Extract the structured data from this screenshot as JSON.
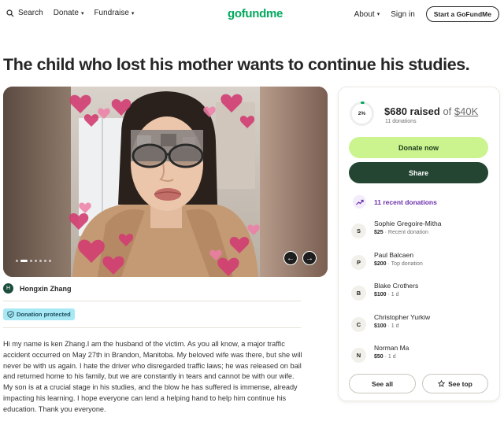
{
  "nav": {
    "search_label": "Search",
    "donate_label": "Donate",
    "fundraise_label": "Fundraise",
    "logo_text": "gofundme",
    "about_label": "About",
    "signin_label": "Sign in",
    "start_label": "Start a GoFundMe",
    "caret": "▾"
  },
  "campaign": {
    "title": "The child who lost his mother wants to continue his studies.",
    "organizer_initial": "H",
    "organizer_name": "Hongxin Zhang",
    "badge_label": "Donation protected",
    "story": "Hi my name is ken Zhang.I am the husband of the victim. As you all know, a major traffic accident occurred on May 27th in Brandon, Manitoba. My beloved wife was there, but she will never be with us again. I hate the driver who disregarded traffic laws; he was released on bail and returned home to his family, but we are constantly in tears and cannot be with our wife. My son is at a crucial stage in his studies, and the blow he has suffered is immense, already impacting his learning. I hope everyone can lend a helping hand to help him continue his education. Thank you everyone.",
    "carousel": {
      "prev_glyph": "←",
      "next_glyph": "→",
      "slide_count": 7,
      "active_slide": 2
    }
  },
  "donation_card": {
    "progress_percent": 2,
    "progress_label": "2%",
    "raised_amount": "$680 raised",
    "of_text": " of ",
    "goal": "$40K",
    "donation_count": "11 donations",
    "donate_button": "Donate now",
    "share_button": "Share",
    "recent_label": "11 recent donations",
    "donors": [
      {
        "initial": "S",
        "name": "Sophie Gregoire-Mitha",
        "amount": "$25",
        "meta": " · Recent donation"
      },
      {
        "initial": "P",
        "name": "Paul Balcaen",
        "amount": "$200",
        "meta": " · Top donation"
      },
      {
        "initial": "B",
        "name": "Blake Crothers",
        "amount": "$100",
        "meta": " · 1 d"
      },
      {
        "initial": "C",
        "name": "Christopher Yurkiw",
        "amount": "$100",
        "meta": " · 1 d"
      },
      {
        "initial": "N",
        "name": "Norman Ma",
        "amount": "$50",
        "meta": " · 1 d"
      }
    ],
    "see_all_button": "See all",
    "see_top_button": "See top"
  },
  "colors": {
    "brand_green": "#02a95c",
    "donate_bg": "#cbf48f",
    "share_bg": "#234532",
    "recent_purple": "#6a2daa",
    "badge_bg": "#a7e8f5"
  }
}
